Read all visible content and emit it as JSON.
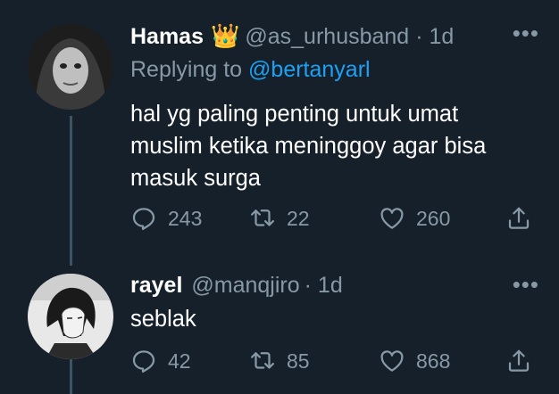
{
  "tweets": [
    {
      "name": "Hamas",
      "badge": "👑",
      "handle": "@as_urhusband",
      "time": "· 1d",
      "replying_label": "Replying to",
      "replying_to": "@bertanyarl",
      "text": "hal yg paling penting untuk umat\nmuslim ketika meninggoy agar bisa\nmasuk surga",
      "replies": "243",
      "retweets": "22",
      "likes": "260"
    },
    {
      "name": "rayel",
      "handle": "@manqjiro",
      "time": "· 1d",
      "text": "seblak",
      "replies": "42",
      "retweets": "85",
      "likes": "868"
    }
  ],
  "icons": {
    "more": "more-horizontal-icon",
    "reply": "reply-icon",
    "retweet": "retweet-icon",
    "like": "heart-icon",
    "share": "share-icon"
  },
  "colors": {
    "background": "#15202b",
    "secondary_text": "#8899a6",
    "link": "#1da1f2",
    "thread_line": "#3d5466"
  }
}
